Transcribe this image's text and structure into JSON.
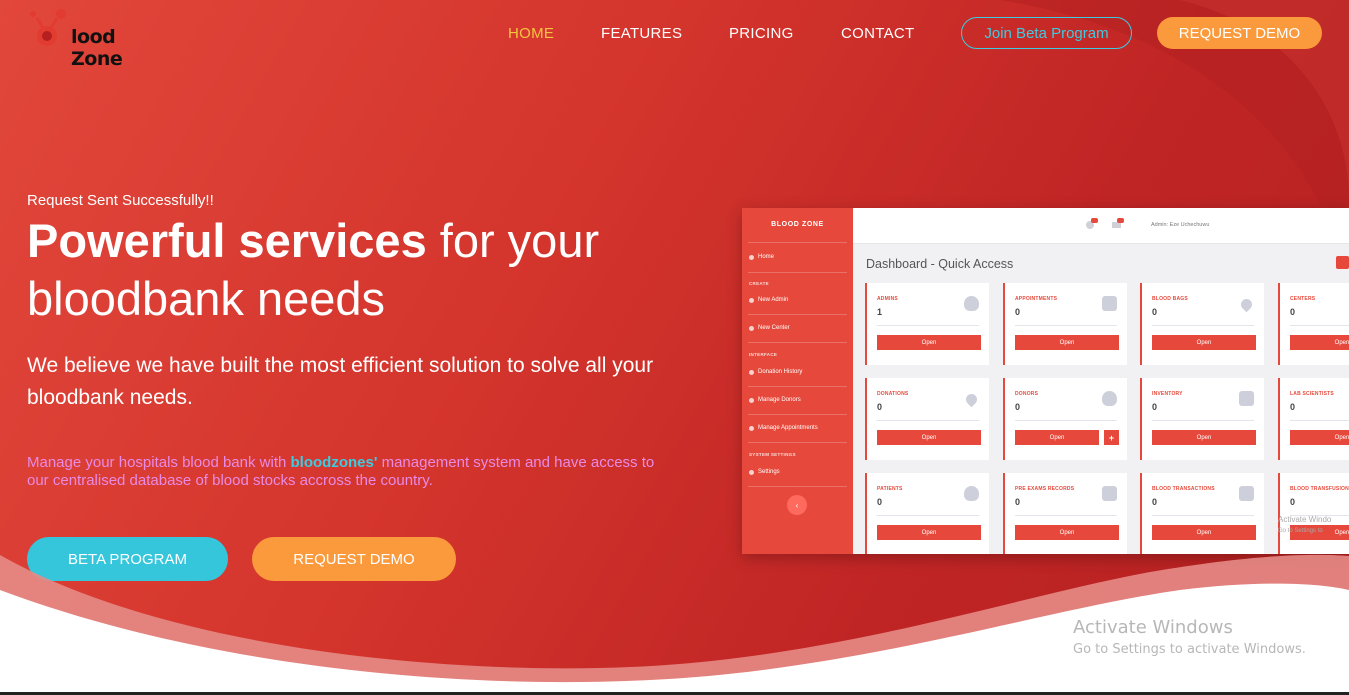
{
  "brand": {
    "name_first": "lood",
    "name_second": "Zone"
  },
  "nav": {
    "links": [
      {
        "label": "HOME"
      },
      {
        "label": "FEATURES"
      },
      {
        "label": "PRICING"
      },
      {
        "label": "CONTACT"
      }
    ],
    "join_beta": "Join Beta Program",
    "request_demo": "REQUEST DEMO"
  },
  "hero": {
    "success_message": "Request Sent Successfully!!",
    "headline_bold": "Powerful services",
    "headline_rest": " for your bloodbank needs",
    "subheadline": "We believe we have built the most efficient solution to solve all your bloodbank needs.",
    "desc_before": "Manage your hospitals blood bank with ",
    "desc_highlight": "bloodzones'",
    "desc_after": " management system and have access to our centralised database of blood stocks accross the country.",
    "beta_button": "BETA PROGRAM",
    "demo_button": "REQUEST DEMO"
  },
  "dashboard": {
    "brand": "BLOOD ZONE",
    "user": "Admin: Eze Uchechuwu",
    "title": "Dashboard - Quick Access",
    "sidebar": {
      "home": "Home",
      "section_create": "CREATE",
      "new_admin": "New Admin",
      "new_center": "New Center",
      "section_interface": "INTERFACE",
      "donation_history": "Donation History",
      "manage_donors": "Manage Donors",
      "manage_appointments": "Manage Appointments",
      "section_system": "SYSTEM SETTINGS",
      "settings": "Settings"
    },
    "open_label": "Open",
    "cards": [
      {
        "label": "ADMINS",
        "value": "1"
      },
      {
        "label": "APPOINTMENTS",
        "value": "0"
      },
      {
        "label": "BLOOD BAGS",
        "value": "0"
      },
      {
        "label": "CENTERS",
        "value": "0"
      },
      {
        "label": "DONATIONS",
        "value": "0"
      },
      {
        "label": "DONORS",
        "value": "0"
      },
      {
        "label": "INVENTORY",
        "value": "0"
      },
      {
        "label": "LAB SCIENTISTS",
        "value": "0"
      },
      {
        "label": "PATIENTS",
        "value": "0"
      },
      {
        "label": "PRE EXAMS RECORDS",
        "value": "0"
      },
      {
        "label": "BLOOD TRANSACTIONS",
        "value": "0"
      },
      {
        "label": "BLOOD TRANSFUSION",
        "value": "0"
      }
    ],
    "watermark_title": "Activate Windo",
    "watermark_sub": "Go to Settings to"
  },
  "os_watermark": {
    "title": "Activate Windows",
    "subtitle": "Go to Settings to activate Windows."
  },
  "colors": {
    "primary_red": "#e6493b",
    "accent_orange": "#fa9a3c",
    "accent_cyan": "#35c6dc",
    "nav_active": "#f5c542",
    "desc_pink": "#e98ae6"
  }
}
